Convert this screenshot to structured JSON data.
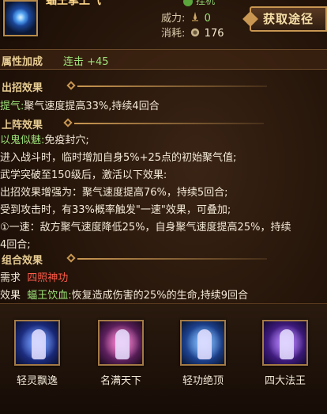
{
  "header": {
    "skill_name": "蝠王掌上气",
    "tag_text": "挂机",
    "power_label": "威力:",
    "power_value": "0",
    "cost_label": "消耗:",
    "cost_value": "176",
    "acquire_label": "获取途径"
  },
  "attr": {
    "label": "属性加成",
    "value": "连击 +45"
  },
  "sections": {
    "attack": {
      "title": "出招效果",
      "line1_prefix": "提气:",
      "line1_text": "聚气速度提高33%,持续4回合"
    },
    "deploy": {
      "title": "上阵效果",
      "line1_prefix": "以鬼似魅:",
      "line1_text": "免疫封穴;",
      "line2": "进入战斗时，临时增加自身5%+25点的初始聚气值;",
      "line3": "武学突破至150级后，激活以下效果:",
      "line4": "出招效果增强为：聚气速度提高76%，持续5回合;",
      "line5": "受到攻击时，有33%概率触发\"一速\"效果，可叠加;",
      "line6": "①一速：敌方聚气速度降低25%，自身聚气速度提高25%，持续",
      "line7": "4回合;"
    },
    "combo": {
      "title": "组合效果",
      "need_label": "需求",
      "need_value": "四照神功",
      "effect_label": "效果",
      "effect_name": "蝠王饮血:",
      "effect_text": "恢复造成伤害的25%的生命,持续9回合"
    }
  },
  "skills": [
    {
      "label": "轻灵飘逸",
      "icon": "skill-qinglingpiaoyi-icon",
      "color": "#3a5fd8"
    },
    {
      "label": "名满天下",
      "icon": "skill-mingmantianxia-icon",
      "color": "#c24a9a"
    },
    {
      "label": "轻功绝顶",
      "icon": "skill-qinggongjueding-icon",
      "color": "#3b78d6"
    },
    {
      "label": "四大法王",
      "icon": "skill-sidafawang-icon",
      "color": "#7a3ad0"
    }
  ],
  "colors": {
    "gold": "#e7cc92",
    "green": "#9de37a",
    "red": "#ff5c4a"
  }
}
